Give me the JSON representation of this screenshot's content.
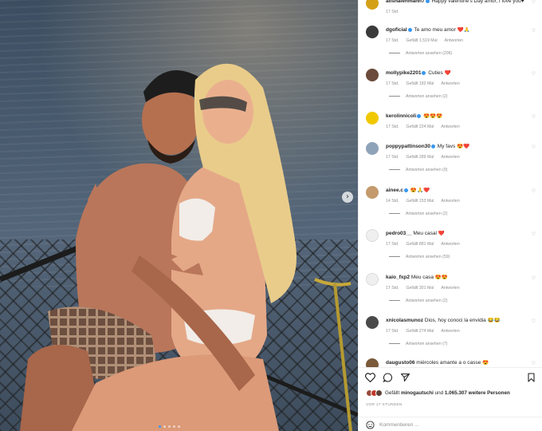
{
  "comments": [
    {
      "user": "alishaiehmann7",
      "verified": true,
      "text": "Happy valentine's Day amor, I love you♥",
      "time": "17 Std.",
      "likes": "",
      "reply": "",
      "replies": "",
      "avatar": "#d4a017"
    },
    {
      "user": "dgoficial",
      "verified": true,
      "text": "Te amo meu amor ❤️🙏",
      "time": "17 Std.",
      "likes": "Gefällt 1.519 Mal",
      "reply": "Antworten",
      "replies": "Antworten ansehen (206)",
      "avatar": "#3a3a3a"
    },
    {
      "user": "mollypike2201",
      "verified": true,
      "text": "Cuties ❤️",
      "time": "17 Std.",
      "likes": "Gefällt 182 Mal",
      "reply": "Antworten",
      "replies": "Antworten ansehen (2)",
      "avatar": "#6b4a3a"
    },
    {
      "user": "kerolinnicoli",
      "verified": true,
      "text": "😍😍😍",
      "time": "17 Std.",
      "likes": "Gefällt 224 Mal",
      "reply": "Antworten",
      "replies": "",
      "avatar": "#f0c800"
    },
    {
      "user": "poppypattinson30",
      "verified": true,
      "text": "My favs 😍❤️",
      "time": "17 Std.",
      "likes": "Gefällt 289 Mal",
      "reply": "Antworten",
      "replies": "Antworten ansehen (9)",
      "avatar": "#8fa3b8"
    },
    {
      "user": "ainee.c",
      "verified": true,
      "text": "😍🙏❤️",
      "time": "14 Std.",
      "likes": "Gefällt 153 Mal",
      "reply": "Antworten",
      "replies": "Antworten ansehen (2)",
      "avatar": "#c49a6c"
    },
    {
      "user": "pedro03__",
      "verified": false,
      "text": "Meu casal ❤️",
      "time": "17 Std.",
      "likes": "Gefällt 881 Mal",
      "reply": "Antworten",
      "replies": "Antworten ansehen (59)",
      "avatar": "empty"
    },
    {
      "user": "kaio_fxp2",
      "verified": false,
      "text": "Meu casa 😍😍",
      "time": "17 Std.",
      "likes": "Gefällt 301 Mal",
      "reply": "Antworten",
      "replies": "Antworten ansehen (2)",
      "avatar": "empty"
    },
    {
      "user": "xnicolasmunoz",
      "verified": false,
      "text": "Dios, hoy conoci la envidia 😂😂",
      "time": "17 Std.",
      "likes": "Gefällt 274 Mal",
      "reply": "Antworten",
      "replies": "Antworten ansehen (7)",
      "avatar": "#4a4a4a"
    },
    {
      "user": "daugusto06",
      "verified": false,
      "text": "miércoles amante a o casse 😍",
      "time": "",
      "likes": "",
      "reply": "",
      "replies": "",
      "avatar": "#7a5a3a"
    }
  ],
  "actions": {
    "like_icon": "heart-outline-icon",
    "comment_icon": "comment-bubble-icon",
    "share_icon": "paper-plane-icon",
    "save_icon": "bookmark-icon"
  },
  "likes_row": {
    "prefix": "Gefällt ",
    "user": "minogautschi",
    "middle": " und ",
    "count": "1.065.307 weitere Personen"
  },
  "timestamp": "VOR 17 STUNDEN",
  "comment_box": {
    "placeholder": "Kommentieren ...",
    "emoji_icon": "smiley-icon"
  },
  "carousel": {
    "next_arrow": "›",
    "slide_count": 5,
    "active_slide": 1
  },
  "colors": {
    "verified": "#3897f0",
    "muted": "#8e8e8e",
    "text": "#262626"
  }
}
